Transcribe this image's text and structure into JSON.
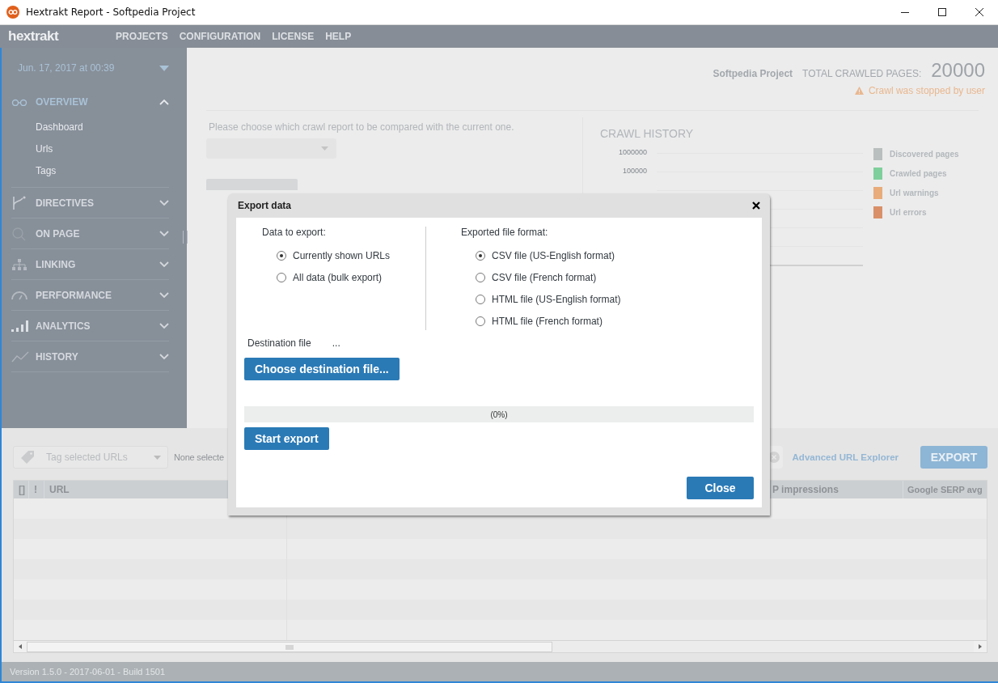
{
  "window": {
    "title": "Hextrakt Report - Softpedia Project"
  },
  "menu": {
    "logo": "hextrakt",
    "items": [
      "PROJECTS",
      "CONFIGURATION",
      "LICENSE",
      "HELP"
    ]
  },
  "sidebar": {
    "crawl_date": "Jun. 17, 2017 at 00:39",
    "sections": [
      {
        "label": "OVERVIEW",
        "expanded": true,
        "children": [
          {
            "label": "Dashboard"
          },
          {
            "label": "Urls"
          },
          {
            "label": "Tags"
          }
        ]
      },
      {
        "label": "DIRECTIVES",
        "expanded": false
      },
      {
        "label": "ON PAGE",
        "expanded": false
      },
      {
        "label": "LINKING",
        "expanded": false
      },
      {
        "label": "PERFORMANCE",
        "expanded": false
      },
      {
        "label": "ANALYTICS",
        "expanded": false
      },
      {
        "label": "HISTORY",
        "expanded": false
      }
    ]
  },
  "header": {
    "project": "Softpedia Project",
    "total_label": "TOTAL CRAWLED PAGES:",
    "total": "20000",
    "warning": "Crawl was stopped by user"
  },
  "compare": {
    "prompt": "Please choose which crawl report to be compared with the current one."
  },
  "crawl_history": {
    "title": "CRAWL HISTORY",
    "y_labels": [
      "1000000",
      "100000"
    ],
    "legend": [
      {
        "label": "Discovered pages",
        "color": "#b9bfbe"
      },
      {
        "label": "Crawled pages",
        "color": "#7fcf9c"
      },
      {
        "label": "Url warnings",
        "color": "#e8ab7a"
      },
      {
        "label": "Url errors",
        "color": "#d99068"
      }
    ]
  },
  "toolbar": {
    "tag_placeholder": "Tag selected URLs",
    "selection": "None selecte",
    "explorer_link": "Advanced URL Explorer",
    "export_button": "EXPORT"
  },
  "table": {
    "columns": [
      {
        "label": "[]"
      },
      {
        "label": "!"
      },
      {
        "label": "URL"
      },
      {
        "label": "P impressions"
      },
      {
        "label": "Google SERP avg"
      }
    ]
  },
  "status_bar": "Version 1.5.0 - 2017-06-01 - Build 1501",
  "dialog": {
    "title": "Export data",
    "data_label": "Data to export:",
    "data_options": [
      {
        "label": "Currently shown URLs",
        "selected": true
      },
      {
        "label": "All data (bulk export)",
        "selected": false
      }
    ],
    "format_label": "Exported file format:",
    "format_options": [
      {
        "label": "CSV file (US-English format)",
        "selected": true
      },
      {
        "label": "CSV file (French format)",
        "selected": false
      },
      {
        "label": "HTML file (US-English format)",
        "selected": false
      },
      {
        "label": "HTML file (French format)",
        "selected": false
      }
    ],
    "destination_label": "Destination file",
    "destination_value": "...",
    "choose_button": "Choose destination file...",
    "progress": {
      "level": 0,
      "text": "(0%)"
    },
    "start_button": "Start export",
    "close_button": "Close"
  }
}
